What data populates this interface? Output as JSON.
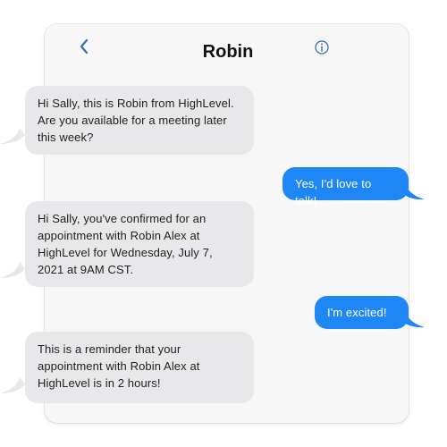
{
  "conversation": {
    "title": "Robin",
    "back_icon": "chevron-left-icon",
    "info_icon": "info-icon"
  },
  "messages": [
    {
      "direction": "incoming",
      "text": "Hi Sally, this is Robin from HighLevel. Are you available for a meeting later this week?"
    },
    {
      "direction": "outgoing",
      "text": "Yes, I'd love to talk!"
    },
    {
      "direction": "incoming",
      "text": "Hi Sally, you've confirmed for an appointment with Robin Alex at HighLevel for Wednesday, July 7, 2021 at 9AM CST."
    },
    {
      "direction": "outgoing",
      "text": "I'm excited!"
    },
    {
      "direction": "incoming",
      "text": "This is a reminder that your appointment with Robin Alex at HighLevel is in 2 hours!"
    }
  ],
  "colors": {
    "incoming_bubble": "#e8e8ea",
    "outgoing_bubble": "#1f86f5",
    "accent": "#2f6fb3"
  }
}
